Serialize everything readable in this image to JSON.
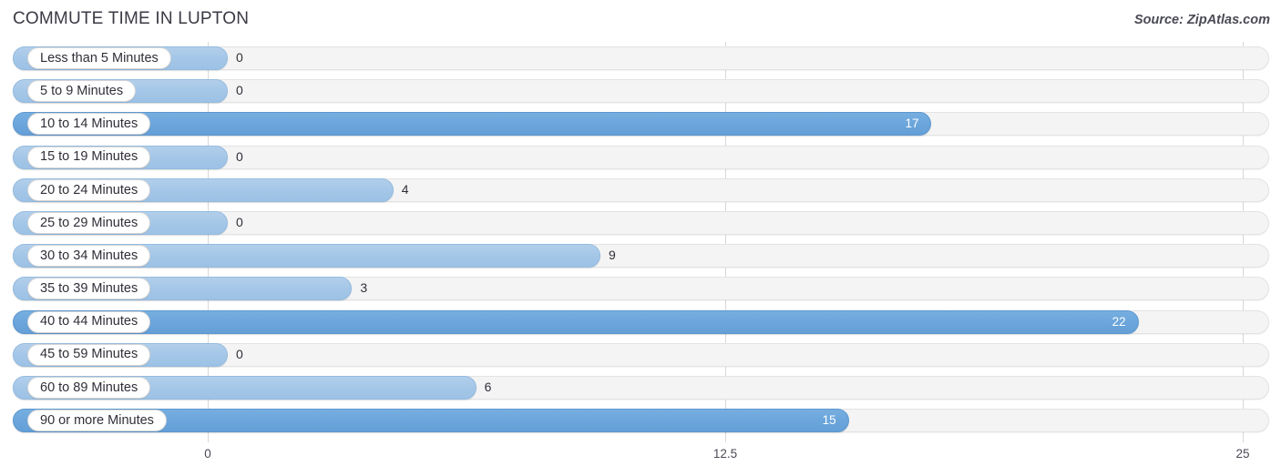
{
  "header": {
    "title": "COMMUTE TIME IN LUPTON",
    "source": "Source: ZipAtlas.com"
  },
  "colors": {
    "bar_light": "#a3c6e7",
    "bar_dark": "#6aa5db",
    "track": "#f4f4f4",
    "gridline": "#d8d8d8",
    "text": "#2f2f38"
  },
  "chart_data": {
    "type": "bar",
    "orientation": "horizontal",
    "title": "COMMUTE TIME IN LUPTON",
    "xlabel": "",
    "ylabel": "",
    "xlim": [
      0,
      25
    ],
    "grid": true,
    "legend": "none",
    "ticks": [
      "0",
      "12.5",
      "25"
    ],
    "tick_values": [
      0,
      12.5,
      25
    ],
    "categories": [
      "Less than 5 Minutes",
      "5 to 9 Minutes",
      "10 to 14 Minutes",
      "15 to 19 Minutes",
      "20 to 24 Minutes",
      "25 to 29 Minutes",
      "30 to 34 Minutes",
      "35 to 39 Minutes",
      "40 to 44 Minutes",
      "45 to 59 Minutes",
      "60 to 89 Minutes",
      "90 or more Minutes"
    ],
    "values": [
      0,
      0,
      17,
      0,
      4,
      0,
      9,
      3,
      22,
      0,
      6,
      15
    ],
    "value_labels": [
      "0",
      "0",
      "17",
      "0",
      "4",
      "0",
      "9",
      "3",
      "22",
      "0",
      "6",
      "15"
    ],
    "rows": [
      {
        "label": "Less than 5 Minutes",
        "value": 0,
        "value_label": "0",
        "shade": "light",
        "label_inside": false
      },
      {
        "label": "5 to 9 Minutes",
        "value": 0,
        "value_label": "0",
        "shade": "light",
        "label_inside": false
      },
      {
        "label": "10 to 14 Minutes",
        "value": 17,
        "value_label": "17",
        "shade": "dark",
        "label_inside": true
      },
      {
        "label": "15 to 19 Minutes",
        "value": 0,
        "value_label": "0",
        "shade": "light",
        "label_inside": false
      },
      {
        "label": "20 to 24 Minutes",
        "value": 4,
        "value_label": "4",
        "shade": "light",
        "label_inside": false
      },
      {
        "label": "25 to 29 Minutes",
        "value": 0,
        "value_label": "0",
        "shade": "light",
        "label_inside": false
      },
      {
        "label": "30 to 34 Minutes",
        "value": 9,
        "value_label": "9",
        "shade": "light",
        "label_inside": false
      },
      {
        "label": "35 to 39 Minutes",
        "value": 3,
        "value_label": "3",
        "shade": "light",
        "label_inside": false
      },
      {
        "label": "40 to 44 Minutes",
        "value": 22,
        "value_label": "22",
        "shade": "dark",
        "label_inside": true
      },
      {
        "label": "45 to 59 Minutes",
        "value": 0,
        "value_label": "0",
        "shade": "light",
        "label_inside": false
      },
      {
        "label": "60 to 89 Minutes",
        "value": 6,
        "value_label": "6",
        "shade": "light",
        "label_inside": false
      },
      {
        "label": "90 or more Minutes",
        "value": 15,
        "value_label": "15",
        "shade": "dark",
        "label_inside": true
      }
    ]
  }
}
